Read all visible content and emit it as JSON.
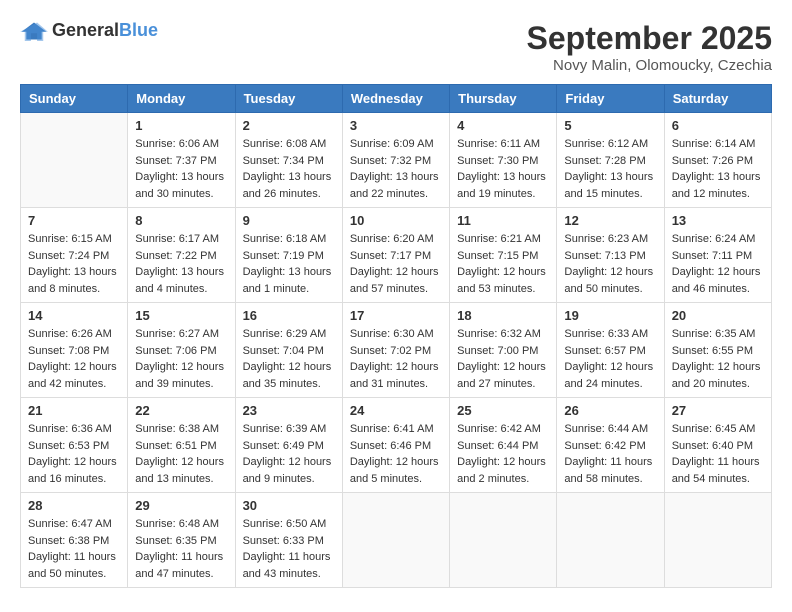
{
  "header": {
    "logo_general": "General",
    "logo_blue": "Blue",
    "month": "September 2025",
    "location": "Novy Malin, Olomoucky, Czechia"
  },
  "weekdays": [
    "Sunday",
    "Monday",
    "Tuesday",
    "Wednesday",
    "Thursday",
    "Friday",
    "Saturday"
  ],
  "weeks": [
    [
      {
        "day": "",
        "info": ""
      },
      {
        "day": "1",
        "info": "Sunrise: 6:06 AM\nSunset: 7:37 PM\nDaylight: 13 hours\nand 30 minutes."
      },
      {
        "day": "2",
        "info": "Sunrise: 6:08 AM\nSunset: 7:34 PM\nDaylight: 13 hours\nand 26 minutes."
      },
      {
        "day": "3",
        "info": "Sunrise: 6:09 AM\nSunset: 7:32 PM\nDaylight: 13 hours\nand 22 minutes."
      },
      {
        "day": "4",
        "info": "Sunrise: 6:11 AM\nSunset: 7:30 PM\nDaylight: 13 hours\nand 19 minutes."
      },
      {
        "day": "5",
        "info": "Sunrise: 6:12 AM\nSunset: 7:28 PM\nDaylight: 13 hours\nand 15 minutes."
      },
      {
        "day": "6",
        "info": "Sunrise: 6:14 AM\nSunset: 7:26 PM\nDaylight: 13 hours\nand 12 minutes."
      }
    ],
    [
      {
        "day": "7",
        "info": "Sunrise: 6:15 AM\nSunset: 7:24 PM\nDaylight: 13 hours\nand 8 minutes."
      },
      {
        "day": "8",
        "info": "Sunrise: 6:17 AM\nSunset: 7:22 PM\nDaylight: 13 hours\nand 4 minutes."
      },
      {
        "day": "9",
        "info": "Sunrise: 6:18 AM\nSunset: 7:19 PM\nDaylight: 13 hours\nand 1 minute."
      },
      {
        "day": "10",
        "info": "Sunrise: 6:20 AM\nSunset: 7:17 PM\nDaylight: 12 hours\nand 57 minutes."
      },
      {
        "day": "11",
        "info": "Sunrise: 6:21 AM\nSunset: 7:15 PM\nDaylight: 12 hours\nand 53 minutes."
      },
      {
        "day": "12",
        "info": "Sunrise: 6:23 AM\nSunset: 7:13 PM\nDaylight: 12 hours\nand 50 minutes."
      },
      {
        "day": "13",
        "info": "Sunrise: 6:24 AM\nSunset: 7:11 PM\nDaylight: 12 hours\nand 46 minutes."
      }
    ],
    [
      {
        "day": "14",
        "info": "Sunrise: 6:26 AM\nSunset: 7:08 PM\nDaylight: 12 hours\nand 42 minutes."
      },
      {
        "day": "15",
        "info": "Sunrise: 6:27 AM\nSunset: 7:06 PM\nDaylight: 12 hours\nand 39 minutes."
      },
      {
        "day": "16",
        "info": "Sunrise: 6:29 AM\nSunset: 7:04 PM\nDaylight: 12 hours\nand 35 minutes."
      },
      {
        "day": "17",
        "info": "Sunrise: 6:30 AM\nSunset: 7:02 PM\nDaylight: 12 hours\nand 31 minutes."
      },
      {
        "day": "18",
        "info": "Sunrise: 6:32 AM\nSunset: 7:00 PM\nDaylight: 12 hours\nand 27 minutes."
      },
      {
        "day": "19",
        "info": "Sunrise: 6:33 AM\nSunset: 6:57 PM\nDaylight: 12 hours\nand 24 minutes."
      },
      {
        "day": "20",
        "info": "Sunrise: 6:35 AM\nSunset: 6:55 PM\nDaylight: 12 hours\nand 20 minutes."
      }
    ],
    [
      {
        "day": "21",
        "info": "Sunrise: 6:36 AM\nSunset: 6:53 PM\nDaylight: 12 hours\nand 16 minutes."
      },
      {
        "day": "22",
        "info": "Sunrise: 6:38 AM\nSunset: 6:51 PM\nDaylight: 12 hours\nand 13 minutes."
      },
      {
        "day": "23",
        "info": "Sunrise: 6:39 AM\nSunset: 6:49 PM\nDaylight: 12 hours\nand 9 minutes."
      },
      {
        "day": "24",
        "info": "Sunrise: 6:41 AM\nSunset: 6:46 PM\nDaylight: 12 hours\nand 5 minutes."
      },
      {
        "day": "25",
        "info": "Sunrise: 6:42 AM\nSunset: 6:44 PM\nDaylight: 12 hours\nand 2 minutes."
      },
      {
        "day": "26",
        "info": "Sunrise: 6:44 AM\nSunset: 6:42 PM\nDaylight: 11 hours\nand 58 minutes."
      },
      {
        "day": "27",
        "info": "Sunrise: 6:45 AM\nSunset: 6:40 PM\nDaylight: 11 hours\nand 54 minutes."
      }
    ],
    [
      {
        "day": "28",
        "info": "Sunrise: 6:47 AM\nSunset: 6:38 PM\nDaylight: 11 hours\nand 50 minutes."
      },
      {
        "day": "29",
        "info": "Sunrise: 6:48 AM\nSunset: 6:35 PM\nDaylight: 11 hours\nand 47 minutes."
      },
      {
        "day": "30",
        "info": "Sunrise: 6:50 AM\nSunset: 6:33 PM\nDaylight: 11 hours\nand 43 minutes."
      },
      {
        "day": "",
        "info": ""
      },
      {
        "day": "",
        "info": ""
      },
      {
        "day": "",
        "info": ""
      },
      {
        "day": "",
        "info": ""
      }
    ]
  ]
}
